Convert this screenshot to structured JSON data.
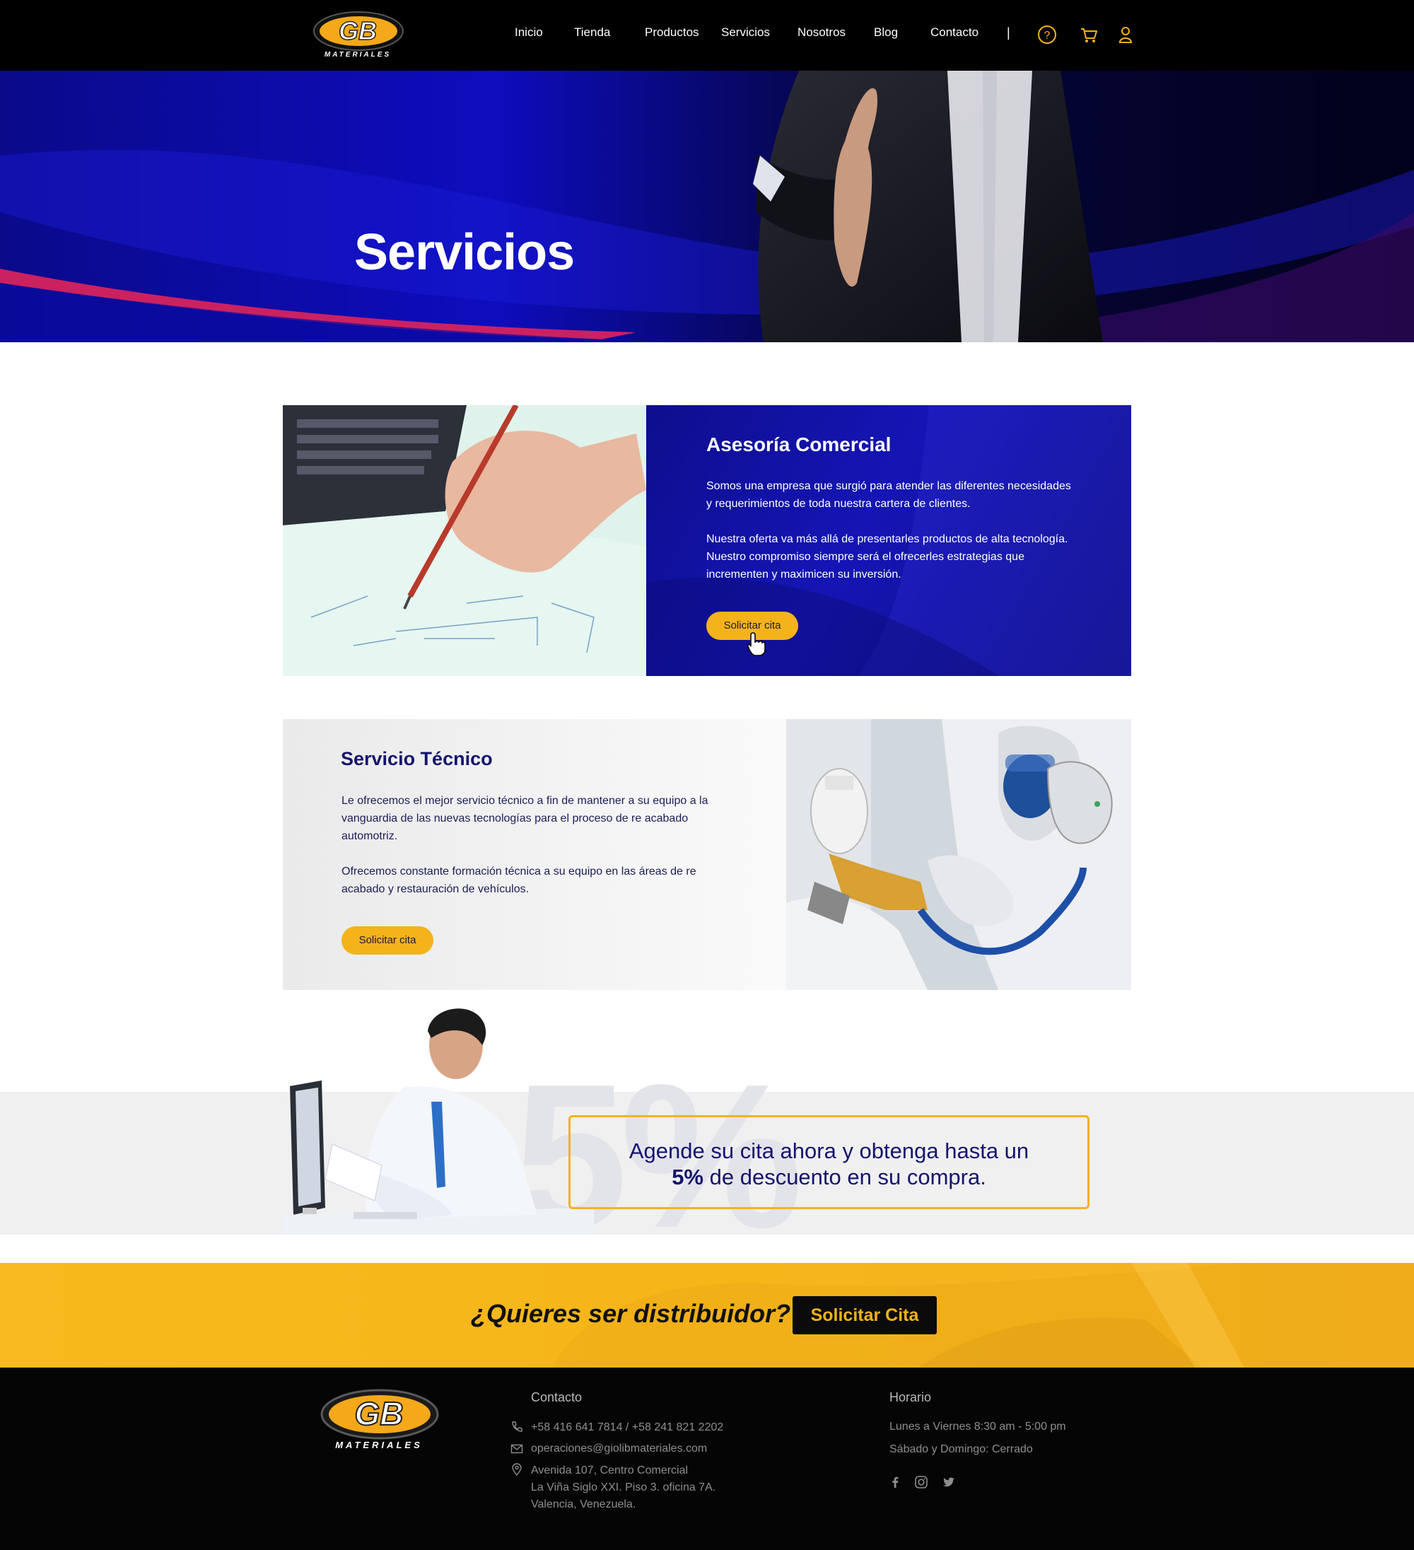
{
  "brand": {
    "logo_text": "GB",
    "logo_sub": "MATERIALES"
  },
  "nav": {
    "items": [
      "Inicio",
      "Tienda",
      "Productos",
      "Servicios",
      "Nosotros",
      "Blog",
      "Contacto"
    ],
    "separator": "|"
  },
  "hero": {
    "title": "Servicios"
  },
  "asesoria": {
    "title": "Asesoría Comercial",
    "p1": "Somos una empresa que surgió para atender las diferentes necesidades y requerimientos de toda nuestra cartera de clientes.",
    "p2": "Nuestra oferta va más allá de presentarles productos de alta tecnología. Nuestro compromiso siempre será el ofrecerles estrategias que incrementen y maximicen su inversión.",
    "button": "Solicitar cita"
  },
  "tecnico": {
    "title": "Servicio Técnico",
    "p1": "Le ofrecemos el mejor servicio técnico a fin de mantener a su equipo a la vanguardia de las nuevas tecnologías para el proceso de re acabado automotriz.",
    "p2": "Ofrecemos constante formación técnica a su equipo en las áreas de re acabado y restauración de vehículos.",
    "button": "Solicitar cita"
  },
  "promo": {
    "big_number": "-5%",
    "line1": "Agende su cita ahora y obtenga hasta un",
    "line2_bold": "5%",
    "line2_rest": " de descuento en su compra."
  },
  "distributor": {
    "question": "¿Quieres ser distribuidor?",
    "button": "Solicitar Cita"
  },
  "footer": {
    "contact_title": "Contacto",
    "phone": "+58 416 641 7814 / +58 241 821 2202",
    "email": "operaciones@giolibmateriales.com",
    "address1": "Avenida 107, Centro Comercial",
    "address2": "La Viña Siglo XXI. Piso 3. oficina 7A.",
    "address3": "Valencia, Venezuela.",
    "hours_title": "Horario",
    "hours1": "Lunes a Viernes 8:30 am - 5:00 pm",
    "hours2": "Sábado y Domingo: Cerrado"
  },
  "colors": {
    "accent": "#f4b31a",
    "navy": "#14146e",
    "hero_blue": "#1515b5",
    "black": "#000000"
  }
}
